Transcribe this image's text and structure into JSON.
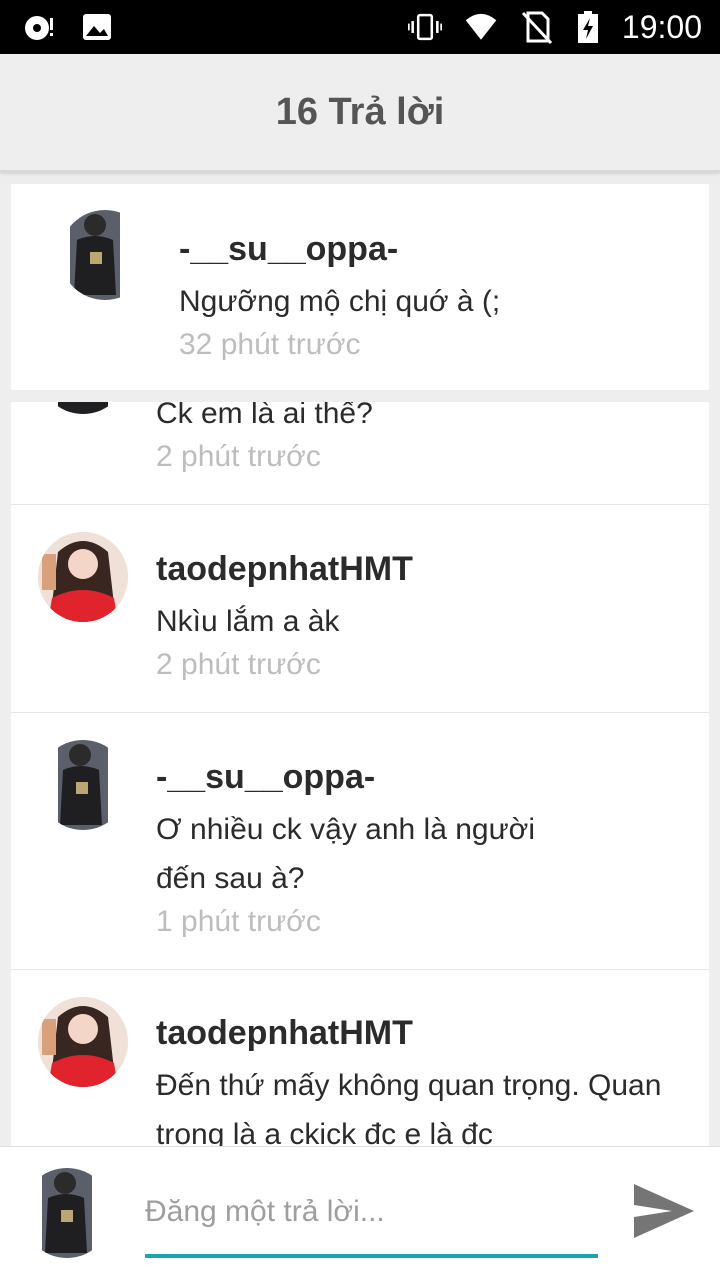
{
  "status_bar": {
    "time": "19:00",
    "left_icons": [
      "debug-icon",
      "image-icon"
    ],
    "right_icons": [
      "vibrate-icon",
      "wifi-icon",
      "no-sim-icon",
      "battery-charging-icon"
    ]
  },
  "header": {
    "title": "16 Trả lời"
  },
  "parent_comment": {
    "username": "-__su__oppa-",
    "text": "Ngưỡng mộ chị quớ à (;",
    "time": "32 phút trước",
    "avatar": "avatar-boy"
  },
  "replies": [
    {
      "text": "Ck em là ai thế?",
      "time": "2 phút trước",
      "avatar": "avatar-boy"
    },
    {
      "username": "taodepnhatHMT",
      "text": "Nkìu lắm a àk",
      "time": "2 phút trước",
      "avatar": "avatar-girl"
    },
    {
      "username": "-__su__oppa-",
      "text_line1": "Ơ nhiều ck vậy anh là người",
      "text_line2": "đến sau à?",
      "time": "1 phút trước",
      "avatar": "avatar-boy"
    },
    {
      "username": "taodepnhatHMT",
      "text_line1": "Đến thứ mấy không quan trọng. Quan",
      "text_line2": "trọng là a ckick đc e là đc",
      "avatar": "avatar-girl"
    }
  ],
  "composer": {
    "placeholder": "Đăng một trả lời...",
    "value": "",
    "send_icon": "send-icon",
    "accent_color": "#18a5b0"
  }
}
